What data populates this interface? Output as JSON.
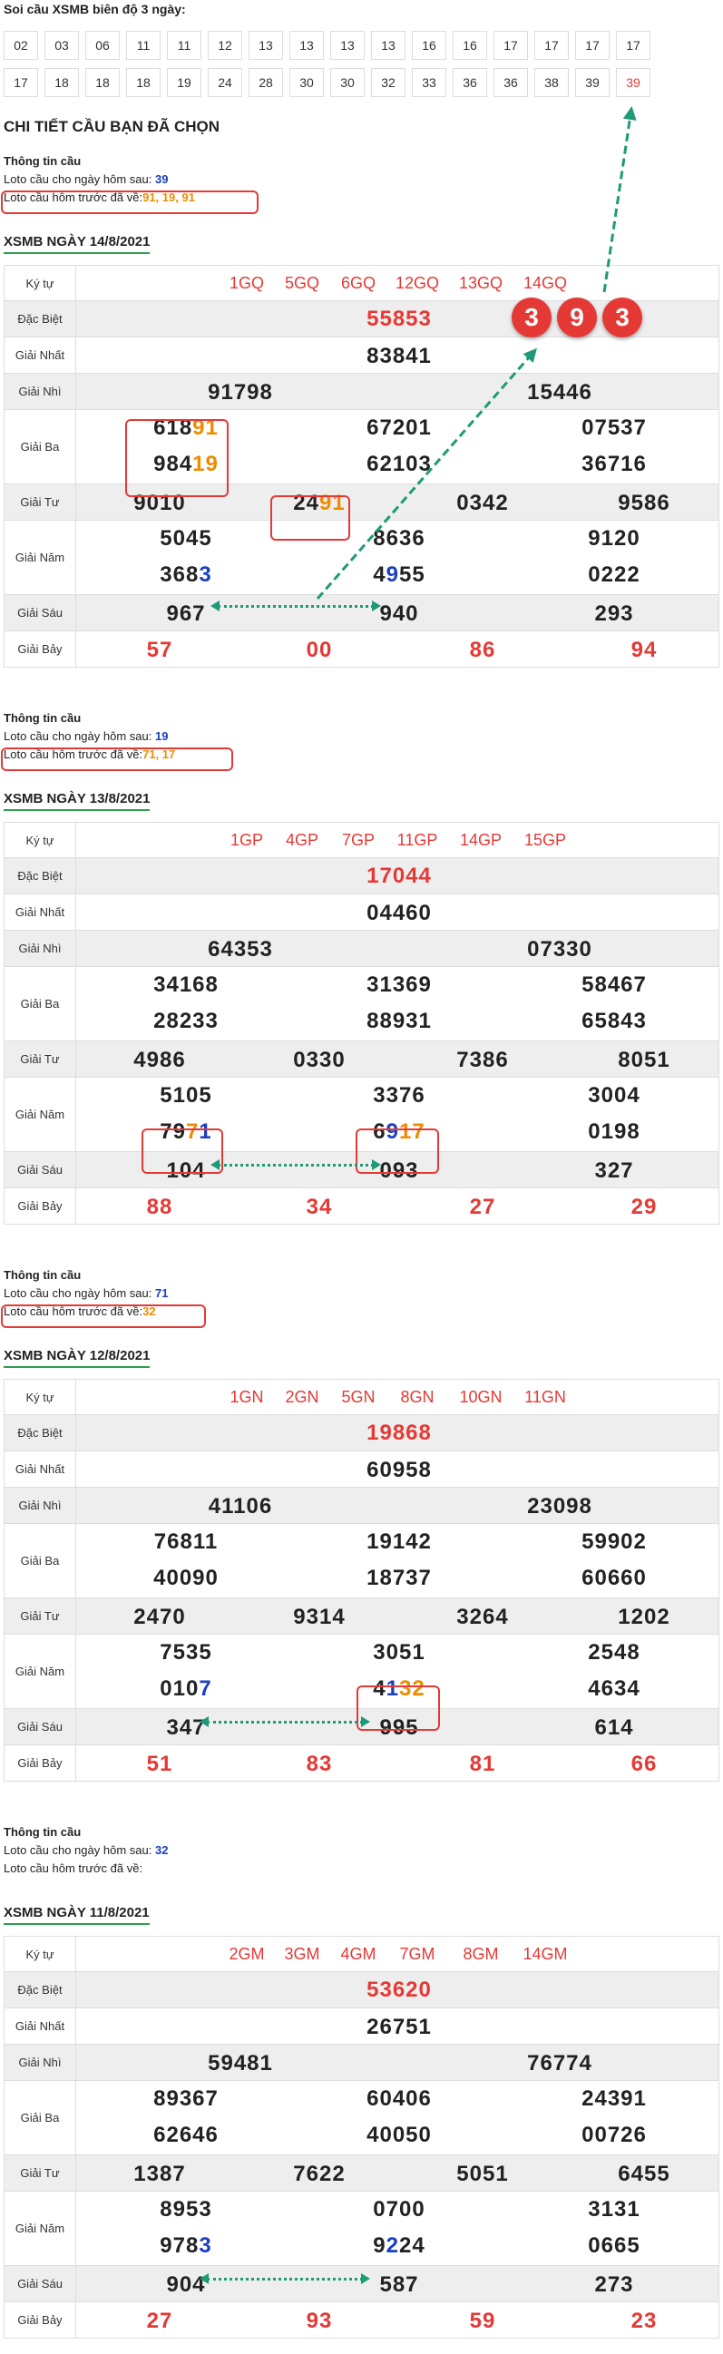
{
  "header": {
    "title": "Soi cầu XSMB biên độ 3 ngày:"
  },
  "chips": [
    "02",
    "03",
    "06",
    "11",
    "11",
    "12",
    "13",
    "13",
    "13",
    "13",
    "16",
    "16",
    "17",
    "17",
    "17",
    "17",
    "17",
    "18",
    "18",
    "18",
    "19",
    "24",
    "28",
    "30",
    "30",
    "32",
    "33",
    "36",
    "36",
    "38",
    "39",
    "39"
  ],
  "chip_highlight_color": "#e53935",
  "detail_title": "CHI TIẾT CẦU BẠN ĐÃ CHỌN",
  "info_label": "Thông tin cầu",
  "next_label": "Loto cầu cho ngày hôm sau:",
  "prev_label": "Loto cầu hôm trước đã về:",
  "labels": {
    "kytu": "Ký tự",
    "db": "Đặc Biệt",
    "g1": "Giải Nhất",
    "g2": "Giải Nhì",
    "g3": "Giải Ba",
    "g4": "Giải Tư",
    "g5": "Giải Năm",
    "g6": "Giải Sáu",
    "g7": "Giải Bảy"
  },
  "balls": [
    "3",
    "9",
    "3"
  ],
  "days": [
    {
      "title": "XSMB NGÀY 14/8/2021",
      "next": "39",
      "prev": "91, 19, 91",
      "codes": [
        "1GQ",
        "5GQ",
        "6GQ",
        "12GQ",
        "13GQ",
        "14GQ"
      ],
      "db": "55853",
      "g1": "83841",
      "g2": [
        "91798",
        "15446"
      ],
      "g3": [
        "61891",
        "67201",
        "07537",
        "98419",
        "62103",
        "36716"
      ],
      "g4": [
        "9010",
        "2491",
        "0342",
        "9586"
      ],
      "g5": [
        "5045",
        "8636",
        "9120",
        "3683",
        "4955",
        "0222"
      ],
      "g6": [
        "967",
        "940",
        "293"
      ],
      "g7": [
        "57",
        "00",
        "86",
        "94"
      ]
    },
    {
      "title": "XSMB NGÀY 13/8/2021",
      "next": "19",
      "prev": "71, 17",
      "codes": [
        "1GP",
        "4GP",
        "7GP",
        "11GP",
        "14GP",
        "15GP"
      ],
      "db": "17044",
      "g1": "04460",
      "g2": [
        "64353",
        "07330"
      ],
      "g3": [
        "34168",
        "31369",
        "58467",
        "28233",
        "88931",
        "65843"
      ],
      "g4": [
        "4986",
        "0330",
        "7386",
        "8051"
      ],
      "g5": [
        "5105",
        "3376",
        "3004",
        "7971",
        "6917",
        "0198"
      ],
      "g6": [
        "104",
        "093",
        "327"
      ],
      "g7": [
        "88",
        "34",
        "27",
        "29"
      ]
    },
    {
      "title": "XSMB NGÀY 12/8/2021",
      "next": "71",
      "prev": "32",
      "codes": [
        "1GN",
        "2GN",
        "5GN",
        "8GN",
        "10GN",
        "11GN"
      ],
      "db": "19868",
      "g1": "60958",
      "g2": [
        "41106",
        "23098"
      ],
      "g3": [
        "76811",
        "19142",
        "59902",
        "40090",
        "18737",
        "60660"
      ],
      "g4": [
        "2470",
        "9314",
        "3264",
        "1202"
      ],
      "g5": [
        "7535",
        "3051",
        "2548",
        "0107",
        "4132",
        "4634"
      ],
      "g6": [
        "347",
        "995",
        "614"
      ],
      "g7": [
        "51",
        "83",
        "81",
        "66"
      ]
    },
    {
      "title": "XSMB NGÀY 11/8/2021",
      "next": "32",
      "prev": "",
      "codes": [
        "2GM",
        "3GM",
        "4GM",
        "7GM",
        "8GM",
        "14GM"
      ],
      "db": "53620",
      "g1": "26751",
      "g2": [
        "59481",
        "76774"
      ],
      "g3": [
        "89367",
        "60406",
        "24391",
        "62646",
        "40050",
        "00726"
      ],
      "g4": [
        "1387",
        "7622",
        "5051",
        "6455"
      ],
      "g5": [
        "8953",
        "0700",
        "3131",
        "9783",
        "9224",
        "0665"
      ],
      "g6": [
        "904",
        "587",
        "273"
      ],
      "g7": [
        "27",
        "93",
        "59",
        "23"
      ]
    }
  ]
}
